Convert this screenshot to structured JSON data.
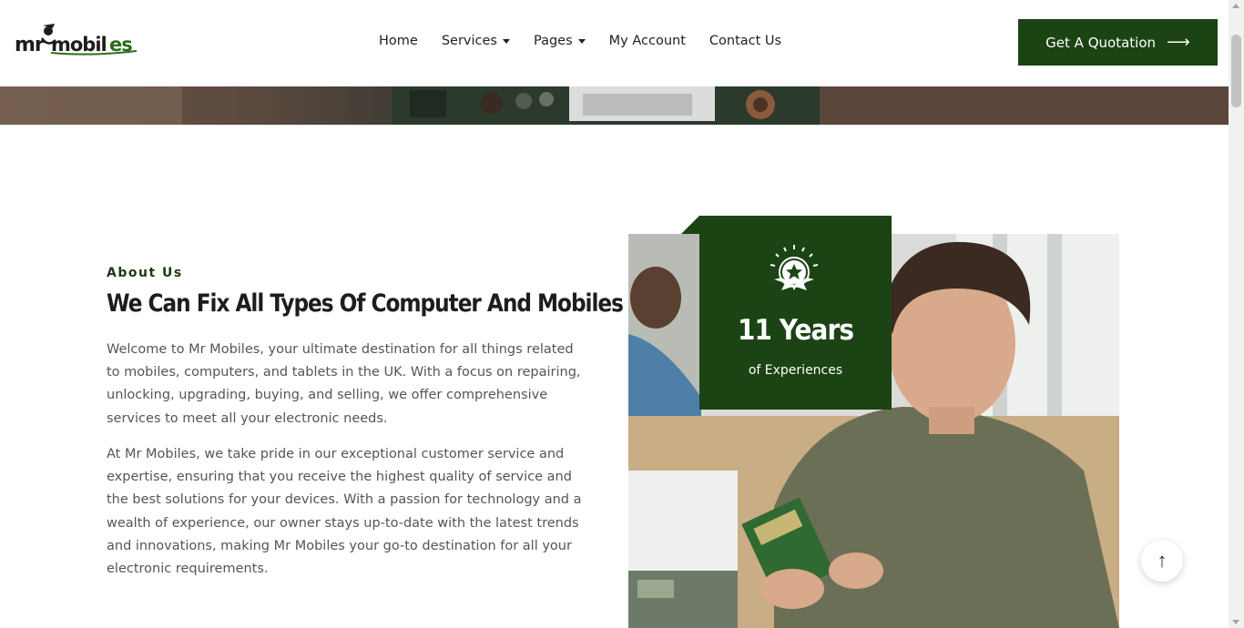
{
  "header": {
    "logo_text": "mr mobiles",
    "nav": [
      {
        "label": "Home",
        "has_dropdown": false
      },
      {
        "label": "Services",
        "has_dropdown": true
      },
      {
        "label": "Pages",
        "has_dropdown": true
      },
      {
        "label": "My Account",
        "has_dropdown": false
      },
      {
        "label": "Contact Us",
        "has_dropdown": false
      }
    ],
    "cta_label": "Get A Quotation",
    "cta_arrow": "⟶"
  },
  "about": {
    "label": "About Us",
    "title": "We Can Fix All Types Of Computer And Mobiles",
    "paragraph_1": "Welcome to Mr Mobiles, your ultimate destination for all things related to mobiles, computers, and tablets in the UK. With a focus on repairing, unlocking, upgrading, buying, and selling, we offer comprehensive services to meet all your electronic needs.",
    "paragraph_2": "At Mr Mobiles, we take pride in our exceptional customer service and expertise, ensuring that you receive the highest quality of service and the best solutions for your devices. With a passion for technology and a wealth of experience, our owner stays up-to-date with the latest trends and innovations, making Mr Mobiles your go-to destination for all your electronic requirements."
  },
  "badge": {
    "years": "11 Years",
    "subtitle": "of Experiences",
    "icon": "award-star-icon"
  },
  "scroll_top": {
    "icon": "arrow-up-icon",
    "glyph": "↑"
  },
  "colors": {
    "brand_green": "#1c4313",
    "text_body": "#555555",
    "heading": "#1d1d1d"
  }
}
